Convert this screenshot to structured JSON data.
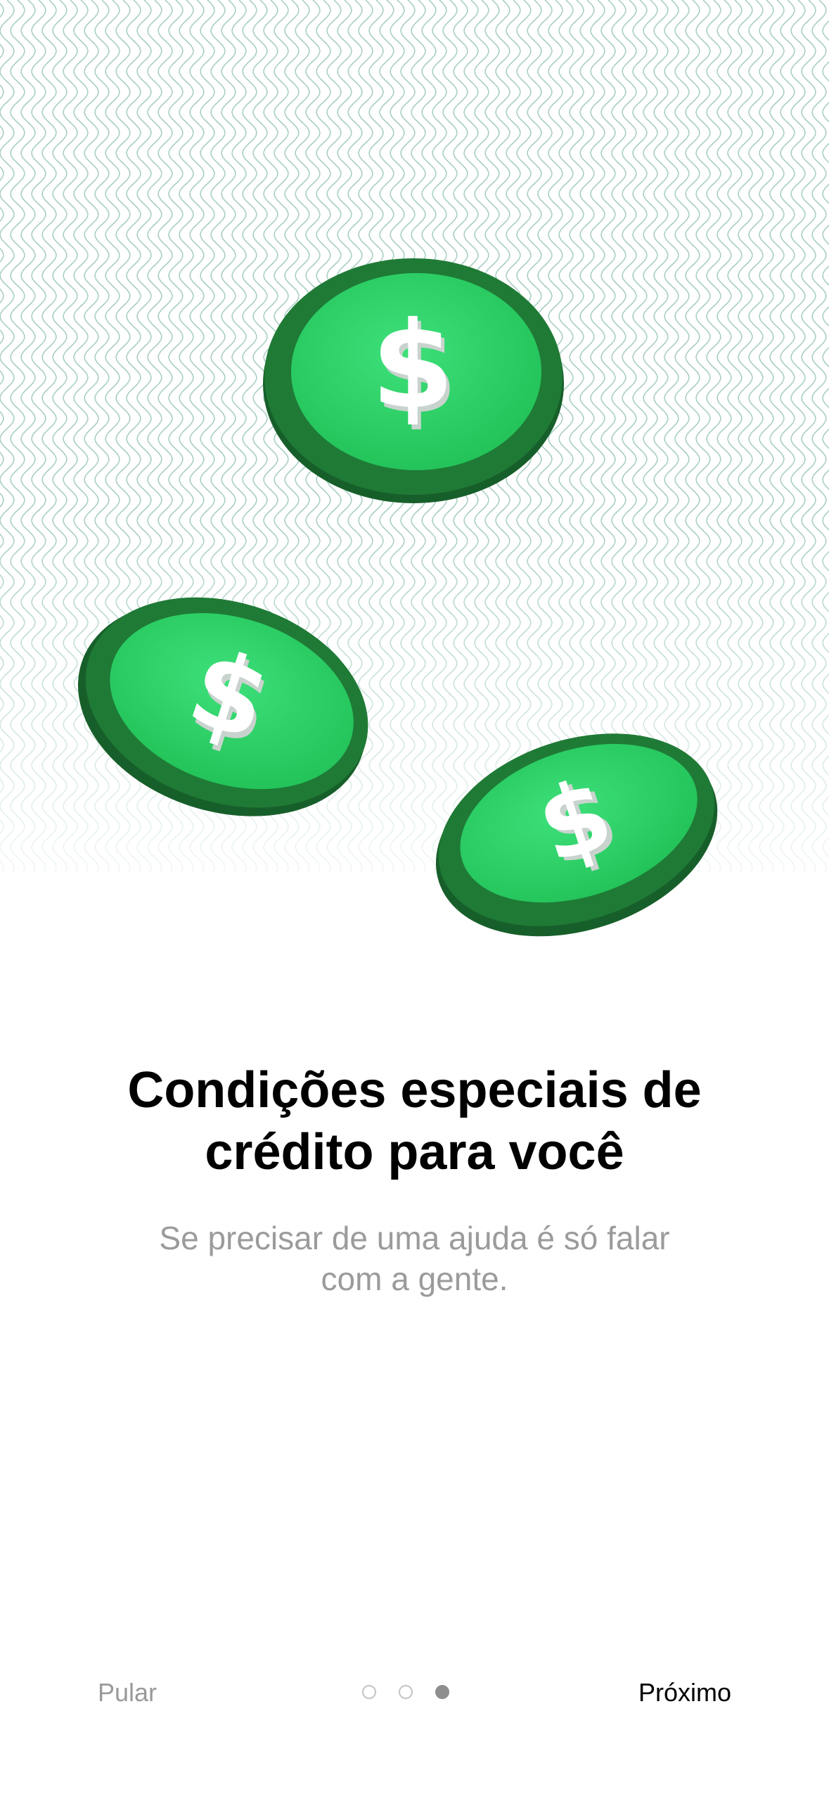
{
  "onboarding": {
    "title_line1": "Condições especiais de",
    "title_line2": "crédito para você",
    "subtitle_line1": "Se precisar de uma ajuda é só falar",
    "subtitle_line2": "com a gente.",
    "illustration": {
      "icon": "dollar-coins-illustration",
      "coin_symbol": "$",
      "coin_color": "#2ed364",
      "coin_rim_color": "#1f7a36",
      "pattern_color": "#a9cfc3"
    }
  },
  "navigation": {
    "skip_label": "Pular",
    "next_label": "Próximo",
    "page_count": 3,
    "active_page": 3
  },
  "colors": {
    "background": "#ffffff",
    "title": "#000000",
    "subtitle": "#9b9b9b",
    "skip": "#9a9a9a",
    "next": "#000000",
    "dot_inactive_border": "#c4c4c4",
    "dot_active": "#8e8e8e"
  }
}
